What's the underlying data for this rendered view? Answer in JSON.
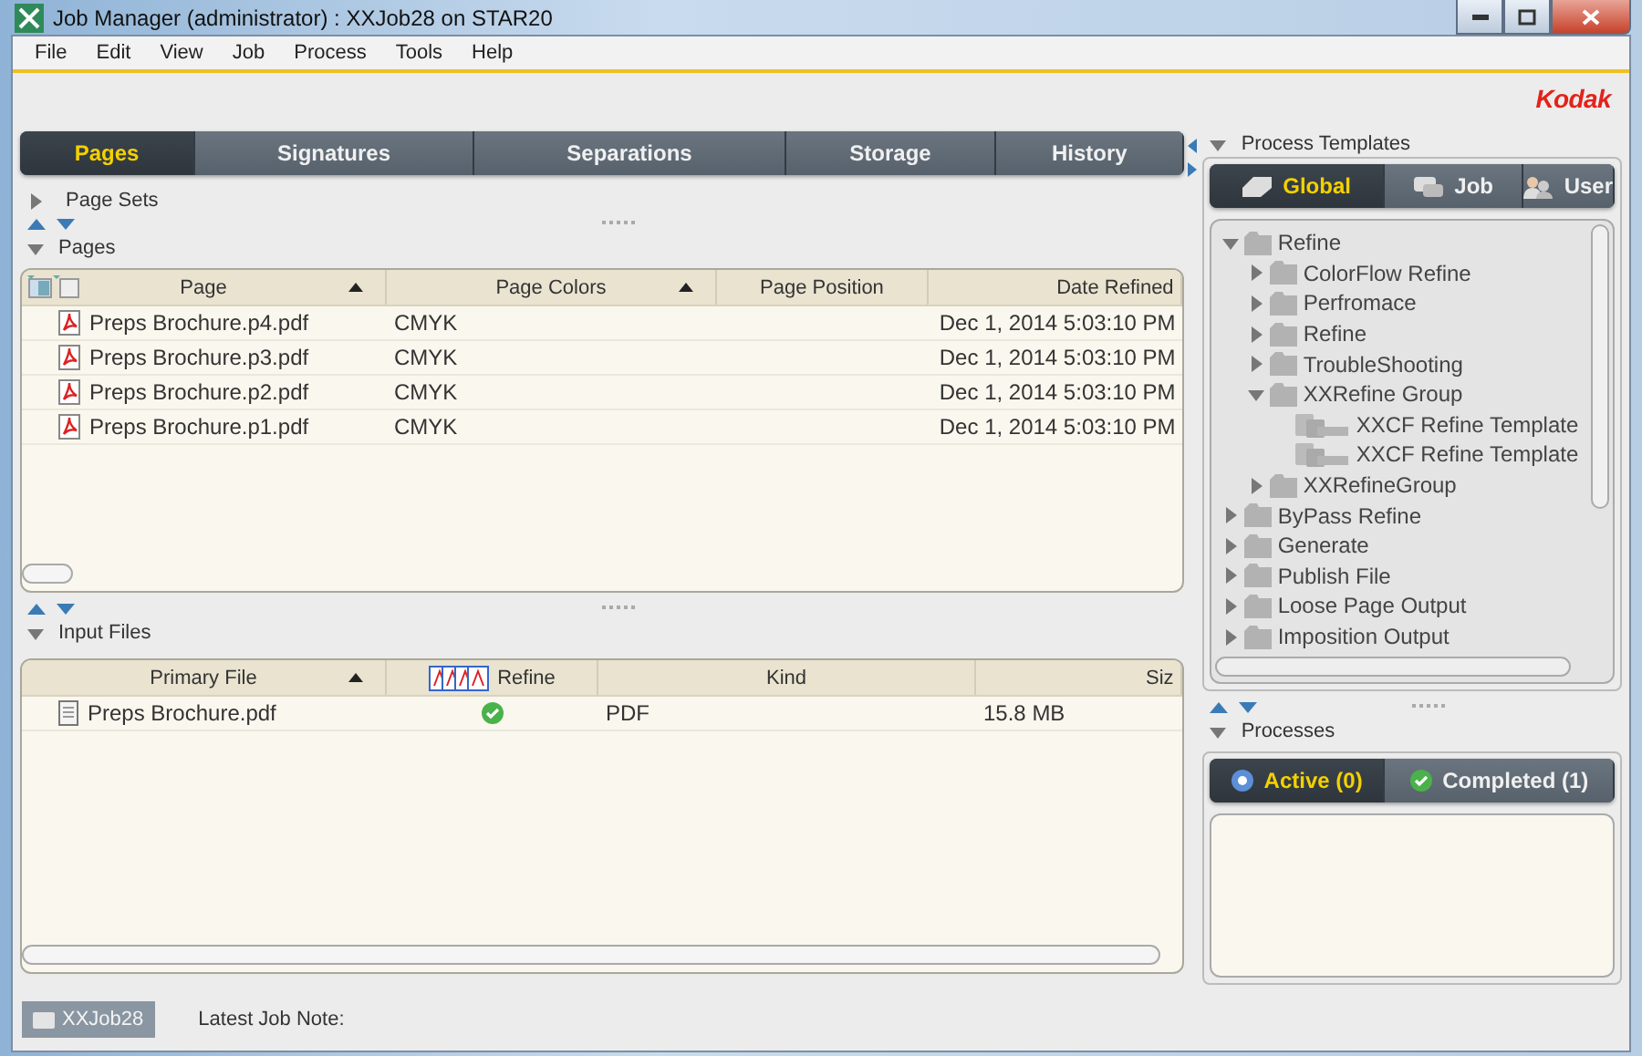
{
  "window": {
    "title": "Job Manager (administrator) : XXJob28 on STAR20"
  },
  "menu": [
    "File",
    "Edit",
    "View",
    "Job",
    "Process",
    "Tools",
    "Help"
  ],
  "brand": "Kodak",
  "main_tabs": [
    {
      "label": "Pages",
      "selected": true
    },
    {
      "label": "Signatures",
      "selected": false
    },
    {
      "label": "Separations",
      "selected": false
    },
    {
      "label": "Storage",
      "selected": false
    },
    {
      "label": "History",
      "selected": false
    }
  ],
  "page_sets": {
    "label": "Page Sets",
    "expanded": false
  },
  "pages": {
    "label": "Pages",
    "expanded": true,
    "columns": [
      {
        "label": "Page",
        "sorted": true
      },
      {
        "label": "Page Colors",
        "sorted": true
      },
      {
        "label": "Page Position",
        "sorted": false
      },
      {
        "label": "Date Refined",
        "sorted": false
      }
    ],
    "rows": [
      {
        "page": "Preps Brochure.p4.pdf",
        "colors": "CMYK",
        "date": "Dec 1, 2014 5:03:10 PM"
      },
      {
        "page": "Preps Brochure.p3.pdf",
        "colors": "CMYK",
        "date": "Dec 1, 2014 5:03:10 PM"
      },
      {
        "page": "Preps Brochure.p2.pdf",
        "colors": "CMYK",
        "date": "Dec 1, 2014 5:03:10 PM"
      },
      {
        "page": "Preps Brochure.p1.pdf",
        "colors": "CMYK",
        "date": "Dec 1, 2014 5:03:10 PM"
      }
    ]
  },
  "input_files": {
    "label": "Input Files",
    "expanded": true,
    "columns": [
      {
        "label": "Primary File",
        "sorted": true
      },
      {
        "label": "Refine",
        "sorted": false
      },
      {
        "label": "Kind",
        "sorted": false
      },
      {
        "label": "Siz",
        "sorted": false
      }
    ],
    "rows": [
      {
        "file": "Preps Brochure.pdf",
        "refined": true,
        "kind": "PDF",
        "size": "15.8 MB"
      }
    ]
  },
  "process_templates": {
    "label": "Process Templates",
    "expanded": true,
    "tabs": [
      {
        "label": "Global",
        "selected": true,
        "kind": "global"
      },
      {
        "label": "Job",
        "selected": false,
        "kind": "job"
      },
      {
        "label": "User",
        "selected": false,
        "kind": "user"
      }
    ],
    "tree": [
      {
        "label": "Refine",
        "kind": "folder",
        "expanded": true,
        "children": [
          {
            "label": "ColorFlow Refine",
            "kind": "folder",
            "expanded": false
          },
          {
            "label": "Perfromace",
            "kind": "folder",
            "expanded": false
          },
          {
            "label": "Refine",
            "kind": "folder",
            "expanded": false
          },
          {
            "label": "TroubleShooting",
            "kind": "folder",
            "expanded": false
          },
          {
            "label": "XXRefine Group",
            "kind": "folder",
            "expanded": true,
            "children": [
              {
                "label": "XXCF Refine Template",
                "kind": "template"
              },
              {
                "label": "XXCF Refine Template",
                "kind": "template"
              }
            ]
          },
          {
            "label": "XXRefineGroup",
            "kind": "folder",
            "expanded": false
          }
        ]
      },
      {
        "label": "ByPass Refine",
        "kind": "folder",
        "expanded": false
      },
      {
        "label": "Generate",
        "kind": "folder",
        "expanded": false
      },
      {
        "label": "Publish File",
        "kind": "folder",
        "expanded": false
      },
      {
        "label": "Loose Page Output",
        "kind": "folder",
        "expanded": false
      },
      {
        "label": "Imposition Output",
        "kind": "folder",
        "expanded": false
      }
    ]
  },
  "processes": {
    "label": "Processes",
    "expanded": true,
    "tabs": [
      {
        "label": "Active (0)",
        "selected": true,
        "kind": "active"
      },
      {
        "label": "Completed (1)",
        "selected": false,
        "kind": "completed"
      }
    ]
  },
  "status_bar": {
    "job": "XXJob28",
    "note_label": "Latest Job Note:"
  }
}
